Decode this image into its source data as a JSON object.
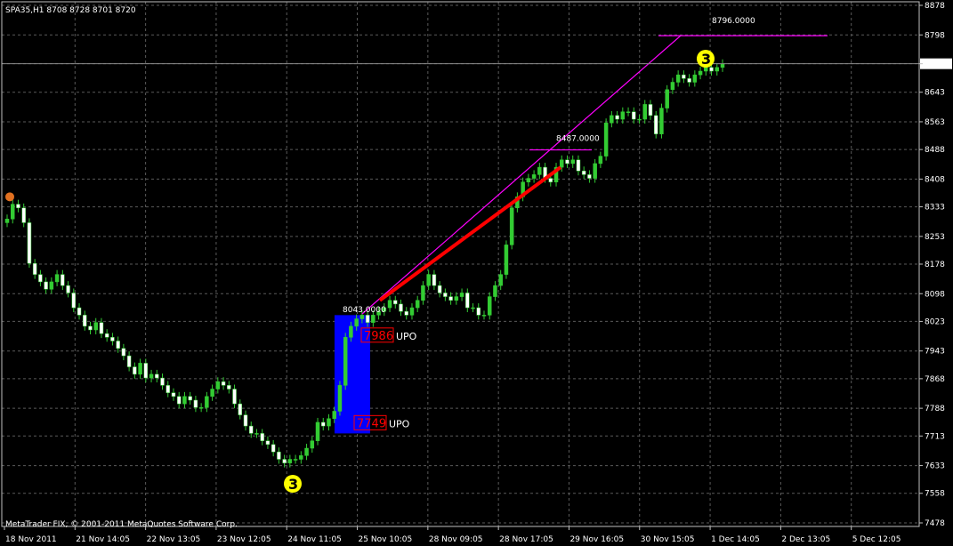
{
  "header": {
    "title": "SPA35,H1  8708 8728 8701 8720"
  },
  "copyright": "MetaTrader FIX, © 2001-2011 MetaQuotes Software Corp.",
  "colors": {
    "background": "#000000",
    "grid": "#5a5a5a",
    "axis": "#c0c0c0",
    "bull_candle": "#33cc33",
    "bear_candle": "#ffffff",
    "trend_line": "#ff00ff",
    "channel_line": "#ff0000",
    "highlight_box": "#0000ff",
    "wave_marker": "#ffff00",
    "pattern_box": "#ff0000"
  },
  "chart_data": {
    "type": "candlestick",
    "symbol": "SPA35",
    "timeframe": "H1",
    "ohlc_header": {
      "open": 8708,
      "high": 8728,
      "low": 8701,
      "close": 8720
    },
    "current_price": 8720,
    "ylim": [
      7478,
      8878
    ],
    "y_ticks": [
      8878,
      8798,
      8720,
      8643,
      8563,
      8488,
      8408,
      8333,
      8253,
      8178,
      8098,
      8023,
      7943,
      7868,
      7788,
      7713,
      7633,
      7558,
      7478
    ],
    "x_ticks": [
      "18 Nov 2011",
      "21 Nov 14:05",
      "22 Nov 13:05",
      "23 Nov 12:05",
      "24 Nov 11:05",
      "25 Nov 10:05",
      "28 Nov 09:05",
      "28 Nov 17:05",
      "29 Nov 16:05",
      "30 Nov 15:05",
      "1 Dec 14:05",
      "2 Dec 13:05",
      "5 Dec 12:05"
    ],
    "grid": true,
    "close_series": [
      8300,
      8340,
      8330,
      8290,
      8180,
      8150,
      8130,
      8110,
      8130,
      8150,
      8120,
      8100,
      8060,
      8040,
      8010,
      8000,
      8020,
      7990,
      7980,
      7970,
      7950,
      7930,
      7900,
      7880,
      7910,
      7870,
      7880,
      7870,
      7850,
      7830,
      7820,
      7800,
      7820,
      7810,
      7790,
      7790,
      7820,
      7840,
      7860,
      7850,
      7840,
      7800,
      7770,
      7740,
      7720,
      7720,
      7700,
      7690,
      7670,
      7650,
      7640,
      7650,
      7650,
      7660,
      7680,
      7700,
      7750,
      7740,
      7760,
      7780,
      7850,
      7980,
      8010,
      8030,
      8040,
      8020,
      8040,
      8050,
      8060,
      8080,
      8070,
      8050,
      8040,
      8060,
      8080,
      8120,
      8150,
      8120,
      8100,
      8090,
      8080,
      8090,
      8100,
      8060,
      8060,
      8040,
      8040,
      8090,
      8120,
      8150,
      8230,
      8330,
      8360,
      8400,
      8410,
      8420,
      8440,
      8410,
      8400,
      8440,
      8460,
      8450,
      8460,
      8430,
      8420,
      8410,
      8450,
      8470,
      8560,
      8580,
      8570,
      8590,
      8590,
      8570,
      8570,
      8610,
      8580,
      8530,
      8600,
      8650,
      8670,
      8690,
      8680,
      8670,
      8690,
      8700,
      8710,
      8700,
      8710,
      8720
    ],
    "annotations": [
      {
        "kind": "level",
        "text": "8796.0000",
        "value": 8796
      },
      {
        "kind": "level",
        "text": "8487.0000",
        "value": 8487
      },
      {
        "kind": "level",
        "text": "8043.0000",
        "value": 8043
      },
      {
        "kind": "pattern",
        "price_text": "7986",
        "tag": "UPO"
      },
      {
        "kind": "pattern",
        "price_text": "7749",
        "tag": "UPO"
      },
      {
        "kind": "wave",
        "text": "3"
      },
      {
        "kind": "wave",
        "text": "3"
      }
    ]
  }
}
